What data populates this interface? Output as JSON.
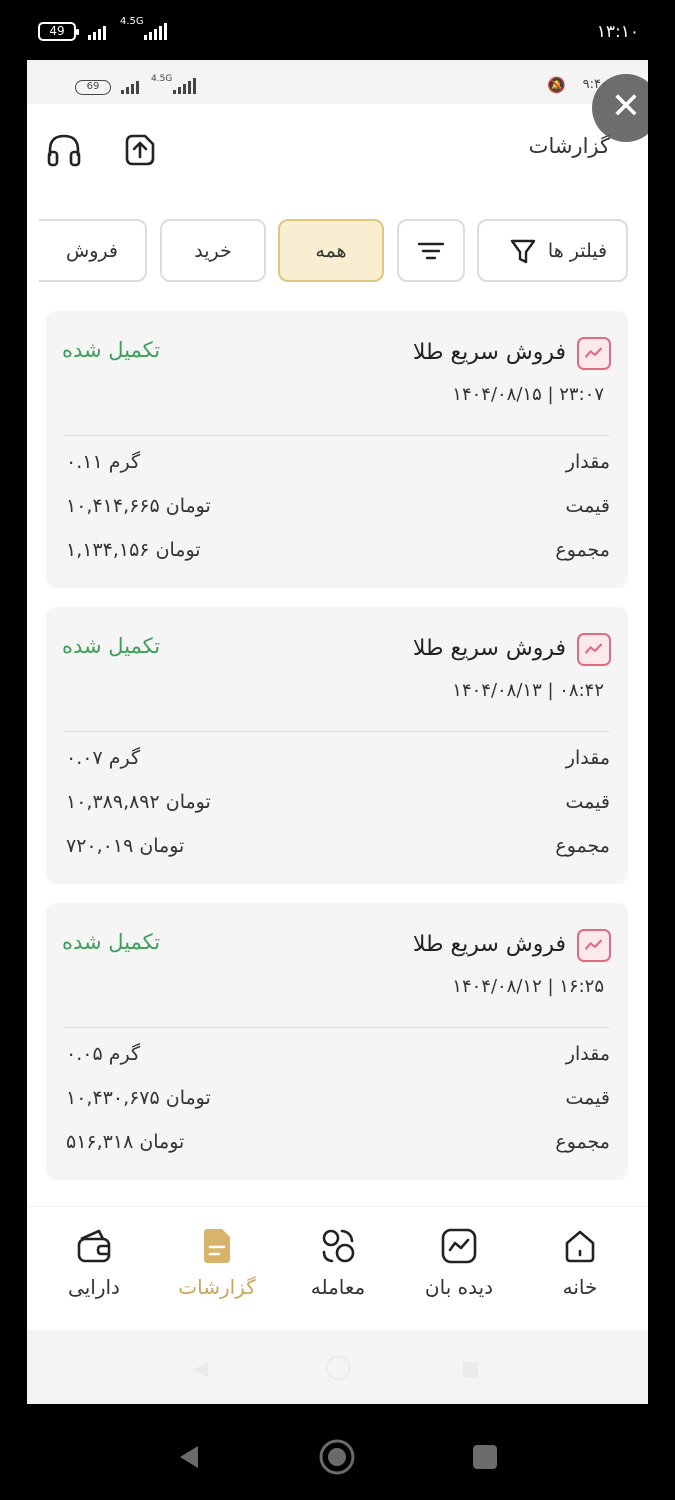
{
  "outer_status": {
    "battery": "49",
    "network": "4.5G",
    "time": "۱۳:۱۰"
  },
  "inner_status": {
    "battery": "69",
    "network": "4.5G",
    "time": "۹:۴۰"
  },
  "header": {
    "title": "گزارشات"
  },
  "filters": {
    "filter_label": "فیلتر ها",
    "chips": [
      "همه",
      "خرید",
      "فروش"
    ],
    "active": "همه"
  },
  "transactions": [
    {
      "title": "فروش  سریع طلا",
      "status": "تکمیل شده",
      "datetime": "۱۴۰۴/۰۸/۱۵ | ۲۳:۰۷",
      "amount_label": "مقدار",
      "amount": "۰.۱۱ گرم",
      "price_label": "قیمت",
      "price": "۱۰,۴۱۴,۶۶۵ تومان",
      "total_label": "مجموع",
      "total": "۱,۱۳۴,۱۵۶ تومان"
    },
    {
      "title": "فروش  سریع طلا",
      "status": "تکمیل شده",
      "datetime": "۱۴۰۴/۰۸/۱۳ | ۰۸:۴۲",
      "amount_label": "مقدار",
      "amount": "۰.۰۷ گرم",
      "price_label": "قیمت",
      "price": "۱۰,۳۸۹,۸۹۲ تومان",
      "total_label": "مجموع",
      "total": "۷۲۰,۰۱۹ تومان"
    },
    {
      "title": "فروش  سریع طلا",
      "status": "تکمیل شده",
      "datetime": "۱۴۰۴/۰۸/۱۲ | ۱۶:۲۵",
      "amount_label": "مقدار",
      "amount": "۰.۰۵ گرم",
      "price_label": "قیمت",
      "price": "۱۰,۴۳۰,۶۷۵ تومان",
      "total_label": "مجموع",
      "total": "۵۱۶,۳۱۸ تومان"
    }
  ],
  "bottom_nav": [
    {
      "label": "خانه",
      "icon": "home-icon"
    },
    {
      "label": "دیده بان",
      "icon": "chart-watch-icon"
    },
    {
      "label": "معامله",
      "icon": "trade-coins-icon"
    },
    {
      "label": "گزارشات",
      "icon": "report-document-icon",
      "active": true
    },
    {
      "label": "دارایی",
      "icon": "wallet-icon"
    }
  ],
  "colors": {
    "accent": "#c8a75a",
    "status_green": "#3f9e5a",
    "chip_active_bg": "#f9eed1",
    "sell_icon": "#e06b7e"
  }
}
